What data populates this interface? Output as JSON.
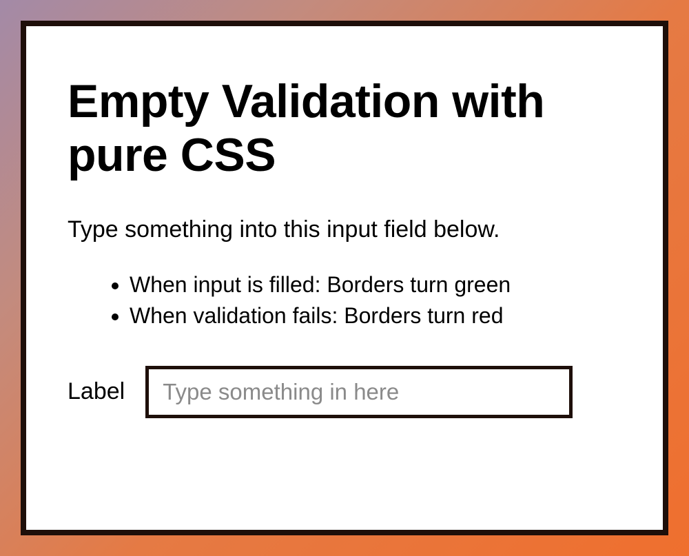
{
  "title": "Empty Validation with pure CSS",
  "instruction": "Type something into this input field below.",
  "rules": [
    "When input is filled: Borders turn green",
    "When validation fails: Borders turn red"
  ],
  "field": {
    "label": "Label",
    "placeholder": "Type something in here",
    "value": ""
  }
}
